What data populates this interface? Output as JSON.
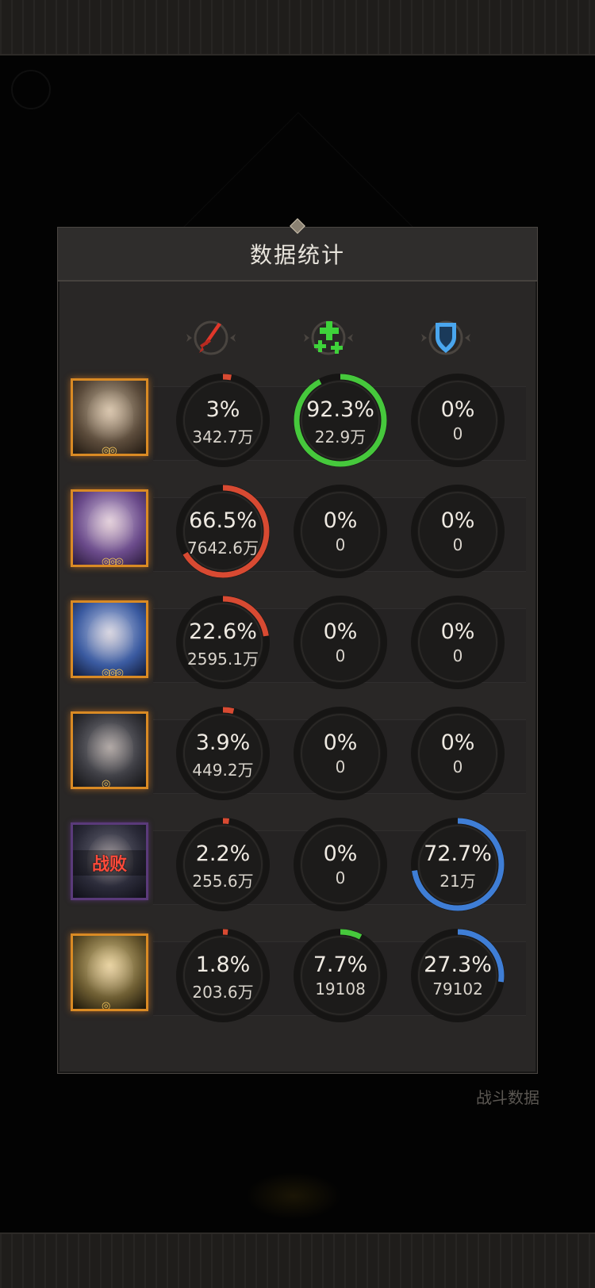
{
  "panel": {
    "title": "数据统计"
  },
  "columns": [
    {
      "icon": "sword-icon",
      "color": "#e0372a"
    },
    {
      "icon": "heal-cross-icon",
      "color": "#3ed23a"
    },
    {
      "icon": "shield-icon",
      "color": "#4aa6ee"
    }
  ],
  "colors": {
    "damage": "#d84a32",
    "heal": "#46c83c",
    "shield": "#3f7ed6",
    "ring_bg": "#161514"
  },
  "background": {
    "battle_data_label": "战斗数据"
  },
  "heroes": [
    {
      "stars": "◎◎",
      "defeated": false,
      "damage": {
        "pct": "3%",
        "value": "342.7万",
        "fraction": 0.03
      },
      "heal": {
        "pct": "92.3%",
        "value": "22.9万",
        "fraction": 0.923
      },
      "shield": {
        "pct": "0%",
        "value": "0",
        "fraction": 0
      }
    },
    {
      "stars": "◎◎◎",
      "defeated": false,
      "damage": {
        "pct": "66.5%",
        "value": "7642.6万",
        "fraction": 0.665
      },
      "heal": {
        "pct": "0%",
        "value": "0",
        "fraction": 0
      },
      "shield": {
        "pct": "0%",
        "value": "0",
        "fraction": 0
      }
    },
    {
      "stars": "◎◎◎",
      "defeated": false,
      "damage": {
        "pct": "22.6%",
        "value": "2595.1万",
        "fraction": 0.226
      },
      "heal": {
        "pct": "0%",
        "value": "0",
        "fraction": 0
      },
      "shield": {
        "pct": "0%",
        "value": "0",
        "fraction": 0
      }
    },
    {
      "stars": "◎",
      "defeated": false,
      "damage": {
        "pct": "3.9%",
        "value": "449.2万",
        "fraction": 0.039
      },
      "heal": {
        "pct": "0%",
        "value": "0",
        "fraction": 0
      },
      "shield": {
        "pct": "0%",
        "value": "0",
        "fraction": 0
      }
    },
    {
      "stars": "",
      "defeated": true,
      "defeat_label": "战败",
      "damage": {
        "pct": "2.2%",
        "value": "255.6万",
        "fraction": 0.022
      },
      "heal": {
        "pct": "0%",
        "value": "0",
        "fraction": 0
      },
      "shield": {
        "pct": "72.7%",
        "value": "21万",
        "fraction": 0.727
      }
    },
    {
      "stars": "◎",
      "defeated": false,
      "damage": {
        "pct": "1.8%",
        "value": "203.6万",
        "fraction": 0.018
      },
      "heal": {
        "pct": "7.7%",
        "value": "19108",
        "fraction": 0.077
      },
      "shield": {
        "pct": "27.3%",
        "value": "79102",
        "fraction": 0.273
      }
    }
  ]
}
